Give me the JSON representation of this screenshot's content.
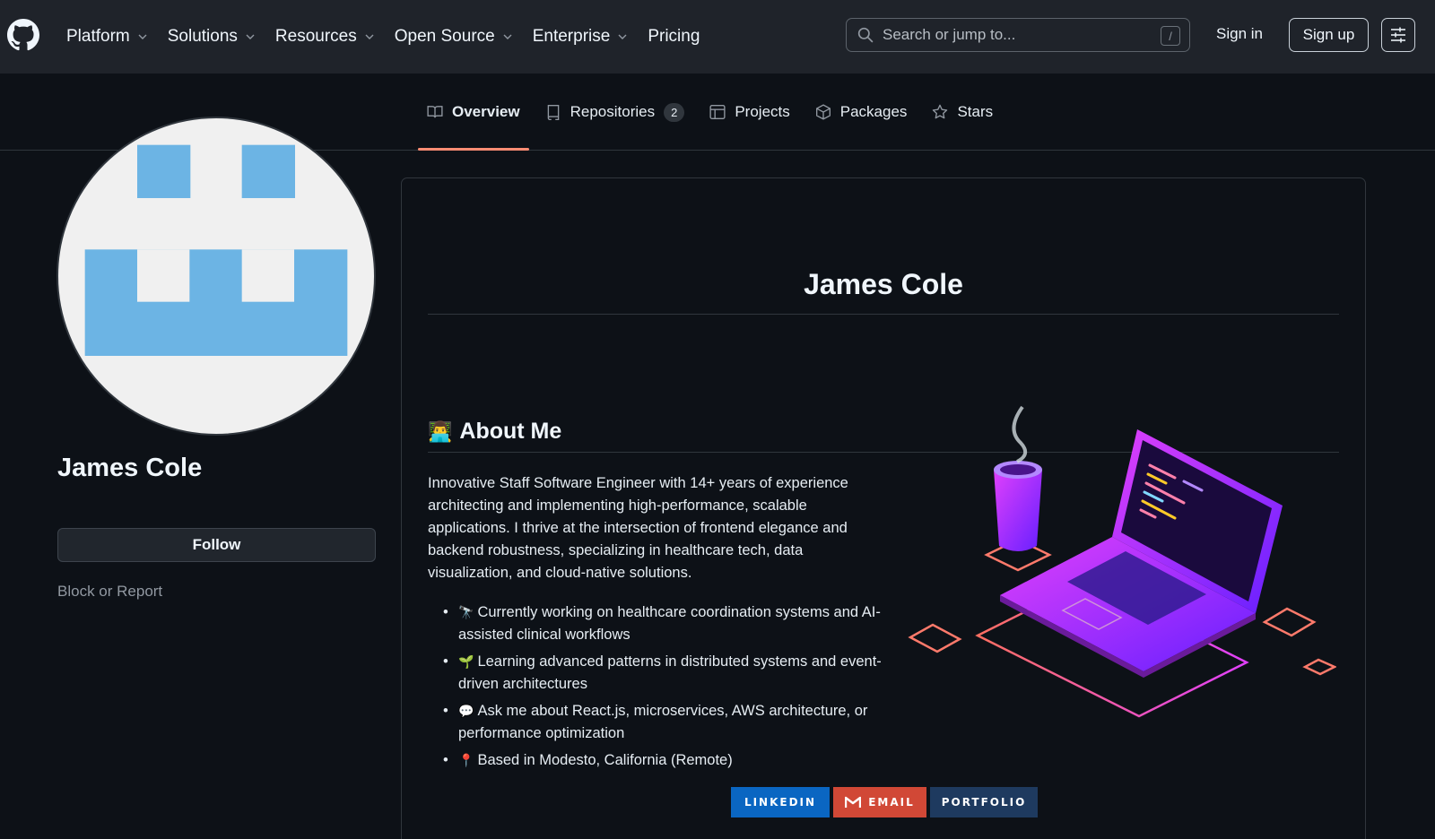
{
  "header": {
    "nav": [
      "Platform",
      "Solutions",
      "Resources",
      "Open Source",
      "Enterprise",
      "Pricing"
    ],
    "search_placeholder": "Search or jump to...",
    "search_shortcut": "/",
    "sign_in": "Sign in",
    "sign_up": "Sign up"
  },
  "tabs": {
    "overview": "Overview",
    "repositories": "Repositories",
    "repositories_count": "2",
    "projects": "Projects",
    "packages": "Packages",
    "stars": "Stars"
  },
  "profile": {
    "name": "James Cole",
    "follow": "Follow",
    "block_report": "Block or Report"
  },
  "readme": {
    "title": "James Cole",
    "about_heading": "About Me",
    "about_emoji": "👨‍💻",
    "bio": "Innovative Staff Software Engineer with 14+ years of experience architecting and implementing high-performance, scalable applications. I thrive at the intersection of frontend elegance and backend robustness, specializing in healthcare tech, data visualization, and cloud-native solutions.",
    "bullets": [
      {
        "emoji": "🔭",
        "text": "Currently working on healthcare coordination systems and AI-assisted clinical workflows"
      },
      {
        "emoji": "🌱",
        "text": "Learning advanced patterns in distributed systems and event-driven architectures"
      },
      {
        "emoji": "💬",
        "text": "Ask me about React.js, microservices, AWS architecture, or performance optimization"
      },
      {
        "emoji": "📍",
        "text": "Based in Modesto, California (Remote)"
      }
    ],
    "badges": {
      "linkedin": "LINKEDIN",
      "email": "EMAIL",
      "portfolio": "PORTFOLIO"
    }
  },
  "colors": {
    "accent_tab": "#fd8c73",
    "avatar_blue": "#6cb4e4",
    "linkedin": "#0a66c2",
    "email": "#d14836",
    "portfolio": "#1e3a5f"
  },
  "icons": [
    "github-logo-icon",
    "chevron-down-icon",
    "search-icon",
    "sliders-icon",
    "book-icon",
    "repo-icon",
    "table-icon",
    "package-icon",
    "star-icon"
  ]
}
